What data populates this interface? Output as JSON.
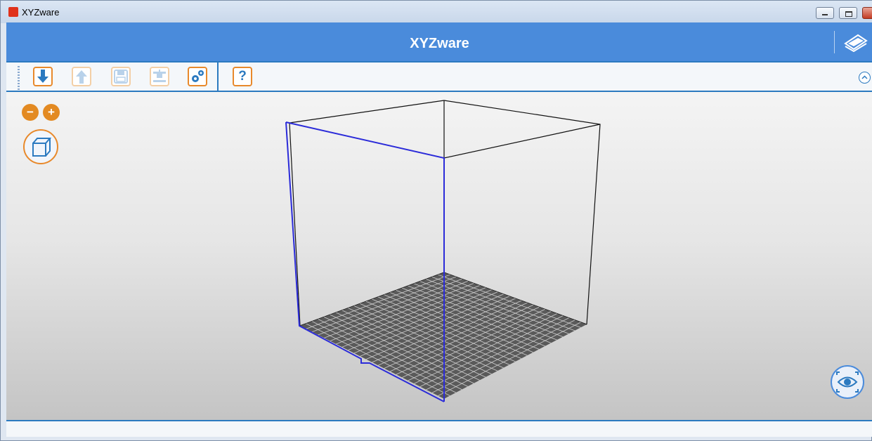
{
  "window": {
    "title": "XYZware"
  },
  "header": {
    "title": "XYZware"
  },
  "toolbar": {
    "tools": [
      {
        "name": "import-button",
        "icon": "download-arrow-icon",
        "enabled": true
      },
      {
        "name": "export-button",
        "icon": "upload-arrow-icon",
        "enabled": false
      },
      {
        "name": "save-button",
        "icon": "floppy-disk-icon",
        "enabled": false
      },
      {
        "name": "print-button",
        "icon": "printer-icon",
        "enabled": false
      },
      {
        "name": "settings-button",
        "icon": "gears-icon",
        "enabled": true
      },
      {
        "name": "help-button",
        "icon": "question-mark-icon",
        "enabled": true
      }
    ],
    "help_label": "?"
  },
  "viewport": {
    "zoom_out_label": "−",
    "zoom_in_label": "+"
  },
  "colors": {
    "brand_blue": "#4a8bdb",
    "accent_orange": "#e8892b",
    "selection_blue": "#2b2bd9"
  }
}
